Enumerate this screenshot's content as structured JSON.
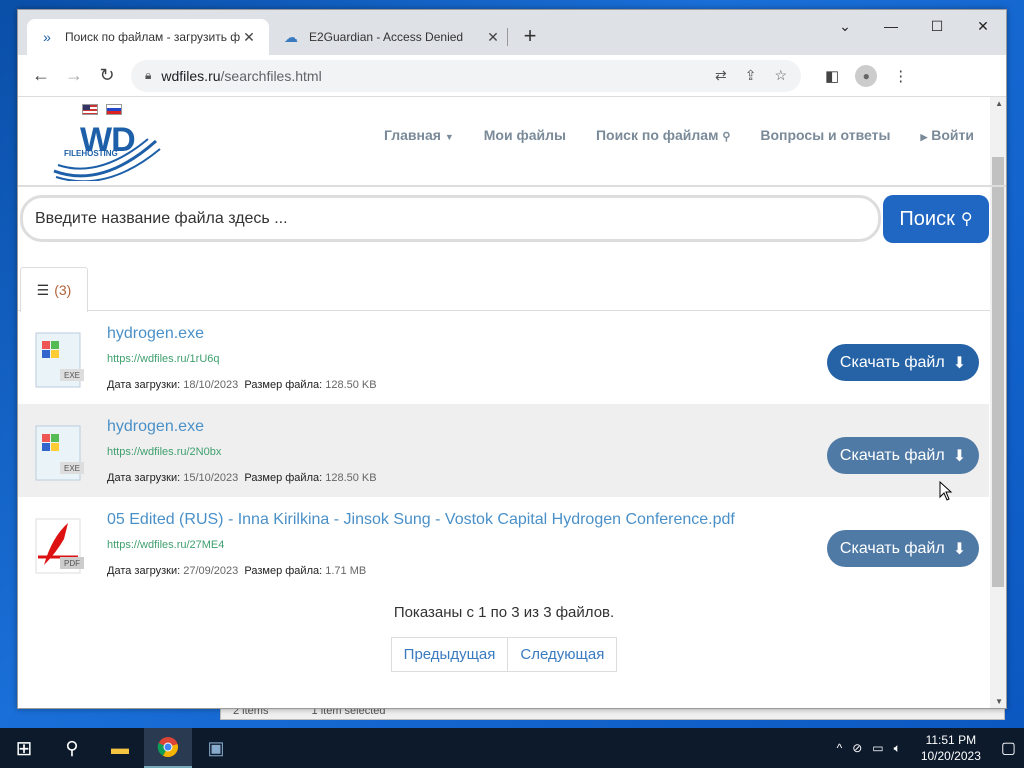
{
  "background_window": {
    "items": "2 items",
    "selected": "1 item selected"
  },
  "browser": {
    "tabs": [
      {
        "title": "Поиск по файлам - загрузить ф",
        "icon": "chevrons-icon"
      },
      {
        "title": "E2Guardian - Access Denied",
        "icon": "cloud-icon"
      }
    ],
    "url_host": "wdfiles.ru",
    "url_path": "/searchfiles.html"
  },
  "site": {
    "logo_text": "WD",
    "logo_sub": "FILEHOSTING",
    "menu": {
      "home": "Главная",
      "my_files": "Мои файлы",
      "search": "Поиск по файлам",
      "faq": "Вопросы и ответы",
      "login": "Войти"
    },
    "search_placeholder": "Введите название файла здесь ...",
    "search_button": "Поиск",
    "results_count": "(3)",
    "labels": {
      "date": "Дата загрузки:",
      "size": "Размер файла:",
      "download": "Скачать файл"
    },
    "files": [
      {
        "name": "hydrogen.exe",
        "url": "https://wdfiles.ru/1rU6q",
        "date": "18/10/2023",
        "size": "128.50 KB",
        "type": "EXE"
      },
      {
        "name": "hydrogen.exe",
        "url": "https://wdfiles.ru/2N0bx",
        "date": "15/10/2023",
        "size": "128.50 KB",
        "type": "EXE"
      },
      {
        "name": "05 Edited (RUS) - Inna Kirilkina - Jinsok Sung - Vostok Capital Hydrogen Conference.pdf",
        "url": "https://wdfiles.ru/27ME4",
        "date": "27/09/2023",
        "size": "1.71 MB",
        "type": "PDF"
      }
    ],
    "summary": "Показаны с 1 по 3 из 3 файлов.",
    "pager": {
      "prev": "Предыдущая",
      "next": "Следующая"
    }
  },
  "taskbar": {
    "time": "11:51 PM",
    "date": "10/20/2023"
  }
}
